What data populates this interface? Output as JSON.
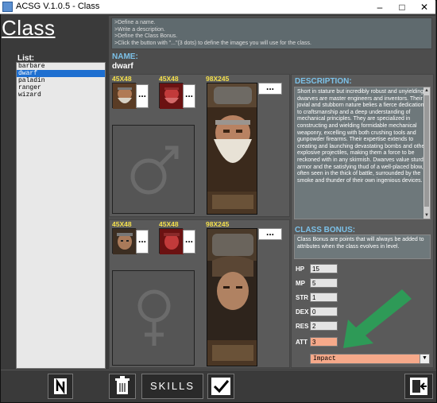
{
  "window": {
    "title": "ACSG V.1.0.5 - Class",
    "minimize_icon": "minimize-icon",
    "maximize_icon": "maximize-icon",
    "close_icon": "close-icon"
  },
  "page_title": "Class",
  "class_list": {
    "label": "List:",
    "items": [
      "barbare",
      "dwarf",
      "paladin",
      "ranger",
      "wizard"
    ],
    "selected": "dwarf"
  },
  "instructions": [
    ">Define a name.",
    ">Write a description.",
    ">Define the Class Bonus.",
    ">Click the button with \"...\"(3 dots) to define the images you will use for the class."
  ],
  "name": {
    "label": "NAME:",
    "value": "dwarf"
  },
  "male_images": {
    "size_small_1": "45X48",
    "size_small_2": "45X48",
    "size_large": "98X245",
    "dots": "...",
    "gender_icon": "male-symbol-icon"
  },
  "female_images": {
    "size_small_1": "45X48",
    "size_small_2": "45X48",
    "size_large": "98X245",
    "dots": "...",
    "gender_icon": "female-symbol-icon"
  },
  "description": {
    "label": "DESCRIPTION:",
    "text": "Short in stature but incredibly robust and unyielding, dwarves are master engineers and inventors. Their jovial and stubborn nature belies a fierce dedication to craftsmanship and a deep understanding of mechanical principles. They are specialized in constructing and wielding formidable mechanical weaponry, excelling with both crushing tools and gunpowder firearms. Their expertise extends to creating and launching devastating bombs and other explosive projectiles, making them a force to be reckoned with in any skirmish. Dwarves value sturdy armor and the satisfying thud of a well-placed blow, often seen in the thick of battle, surrounded by the smoke and thunder of their own ingenious devices."
  },
  "class_bonus": {
    "label": "CLASS BONUS:",
    "text": "Class Bonus are points that will always be added to attributes when the class evolves in level."
  },
  "attributes": [
    {
      "label": "HP",
      "value": "15"
    },
    {
      "label": "MP",
      "value": "5"
    },
    {
      "label": "STR",
      "value": "1"
    },
    {
      "label": "DEX",
      "value": "0"
    },
    {
      "label": "RES",
      "value": "2"
    },
    {
      "label": "ATT",
      "value": "3"
    }
  ],
  "attack_type": {
    "selected": "Impact"
  },
  "footer": {
    "new_icon": "new-document-icon",
    "delete_icon": "trash-icon",
    "skills_label": "SKILLS",
    "confirm_icon": "checkmark-icon",
    "exit_icon": "exit-door-icon"
  },
  "colors": {
    "section_label": "#7cc1e8",
    "size_tag": "#f4e04d",
    "highlight": "#f6a98a",
    "arrow": "#2e9a57",
    "selection": "#1e6fd0"
  }
}
